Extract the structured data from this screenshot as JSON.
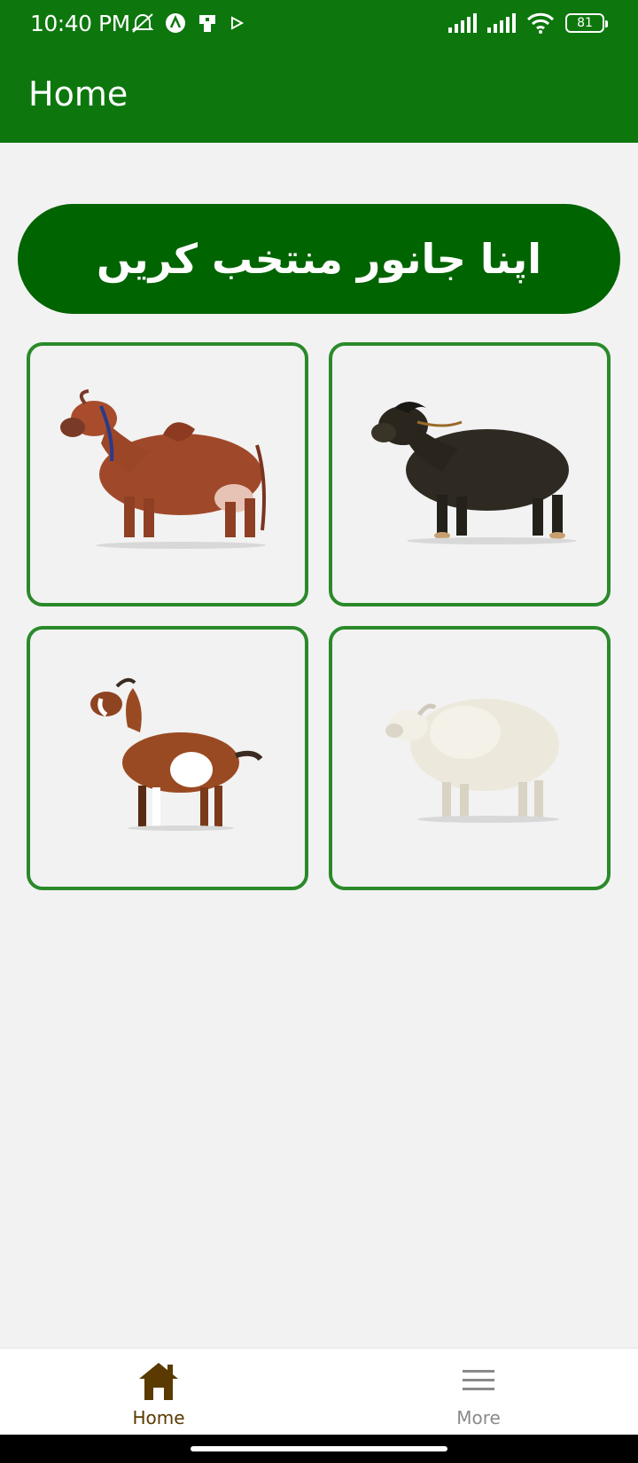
{
  "status_bar": {
    "time": "10:40 PM",
    "battery": "81",
    "icons_left": [
      "mute-icon",
      "notification-a-icon",
      "sim-icon",
      "play-icon"
    ],
    "icons_right": [
      "signal-icon",
      "signal-icon",
      "wifi-icon",
      "battery-icon"
    ]
  },
  "app_bar": {
    "title": "Home"
  },
  "banner": {
    "label": "اپنا جانور منتخب کریں"
  },
  "animals": [
    {
      "id": "cow",
      "icon": "cow-image"
    },
    {
      "id": "buffalo",
      "icon": "buffalo-image"
    },
    {
      "id": "goat",
      "icon": "goat-image"
    },
    {
      "id": "sheep",
      "icon": "sheep-image"
    }
  ],
  "bottom_nav": {
    "home_label": "Home",
    "more_label": "More",
    "home_icon": "home-icon",
    "more_icon": "menu-icon"
  },
  "colors": {
    "primary": "#0d770d",
    "banner": "#006400",
    "card_border": "#2a8a2a",
    "nav_active": "#5a3a00",
    "nav_inactive": "#8a8a8a",
    "background": "#f2f2f2"
  }
}
